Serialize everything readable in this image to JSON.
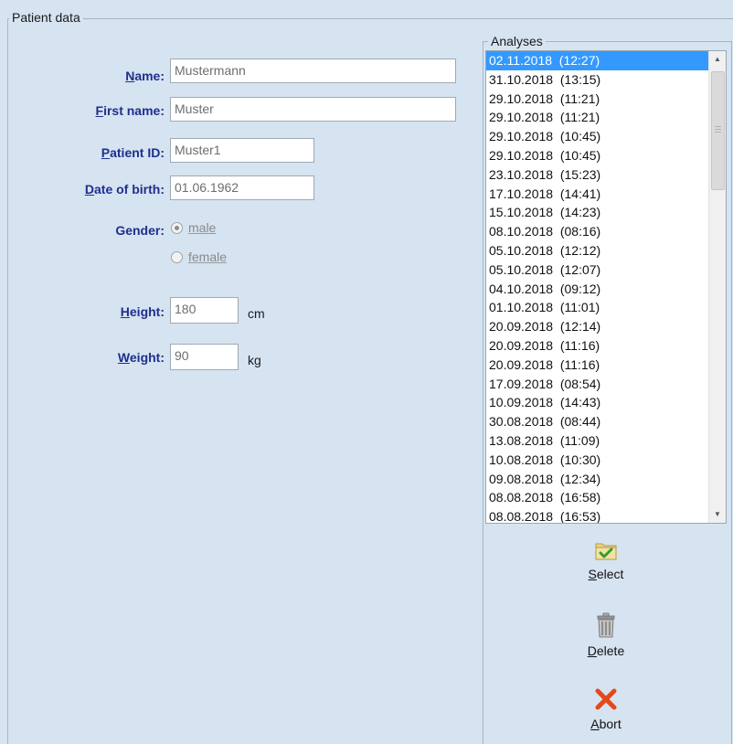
{
  "patient_group": {
    "title": "Patient data"
  },
  "fields": {
    "name": {
      "label_mnemonic": "N",
      "label_rest": "ame:",
      "value": "Mustermann"
    },
    "first_name": {
      "label_mnemonic": "F",
      "label_rest": "irst name:",
      "value": "Muster"
    },
    "patient_id": {
      "label_mnemonic": "P",
      "label_rest": "atient ID:",
      "value": "Muster1"
    },
    "dob": {
      "label_mnemonic": "D",
      "label_rest": "ate of birth:",
      "value": "01.06.1962"
    },
    "gender": {
      "label": "Gender:",
      "options": [
        "male",
        "female"
      ],
      "selected": "male"
    },
    "height": {
      "label_mnemonic": "H",
      "label_rest": "eight:",
      "value": "180",
      "unit": "cm"
    },
    "weight": {
      "label_mnemonic": "W",
      "label_rest": "eight:",
      "value": "90",
      "unit": "kg"
    }
  },
  "analyses": {
    "title": "Analyses",
    "items": [
      "02.11.2018  (12:27)",
      "31.10.2018  (13:15)",
      "29.10.2018  (11:21)",
      "29.10.2018  (11:21)",
      "29.10.2018  (10:45)",
      "29.10.2018  (10:45)",
      "23.10.2018  (15:23)",
      "17.10.2018  (14:41)",
      "15.10.2018  (14:23)",
      "08.10.2018  (08:16)",
      "05.10.2018  (12:12)",
      "05.10.2018  (12:07)",
      "04.10.2018  (09:12)",
      "01.10.2018  (11:01)",
      "20.09.2018  (12:14)",
      "20.09.2018  (11:16)",
      "20.09.2018  (11:16)",
      "17.09.2018  (08:54)",
      "10.09.2018  (14:43)",
      "30.08.2018  (08:44)",
      "13.08.2018  (11:09)",
      "10.08.2018  (10:30)",
      "09.08.2018  (12:34)",
      "08.08.2018  (16:58)",
      "08.08.2018  (16:53)"
    ],
    "selected_index": 0
  },
  "actions": {
    "select": {
      "mnemonic": "S",
      "rest": "elect",
      "icon": "folder-check-icon"
    },
    "delete": {
      "mnemonic": "D",
      "rest": "elete",
      "icon": "trash-icon"
    },
    "abort": {
      "mnemonic": "A",
      "rest": "bort",
      "icon": "red-x-icon"
    }
  },
  "colors": {
    "background": "#d6e3f1",
    "label": "#1e2f8c",
    "selection": "#3399ff",
    "abort": "#e24a1b"
  }
}
